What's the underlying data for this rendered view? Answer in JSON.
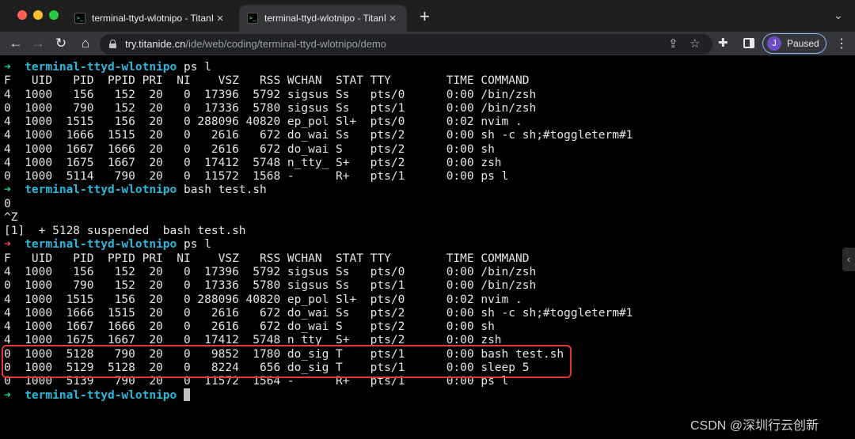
{
  "tabs": [
    {
      "title": "terminal-ttyd-wlotnipo - TitanIDE",
      "icon": "terminal-favicon-icon",
      "active": false
    },
    {
      "title": "terminal-ttyd-wlotnipo - TitanIDE",
      "icon": "terminal-favicon-icon",
      "active": true
    }
  ],
  "toolbar": {
    "url_host": "try.titanide.cn",
    "url_path": "/ide/web/coding/terminal-ttyd-wlotnipo/demo",
    "profile_initial": "J",
    "profile_status": "Paused"
  },
  "terminal": {
    "prompt_symbol": "➜",
    "directory": "terminal-ttyd-wlotnipo",
    "lines": [
      {
        "type": "prompt",
        "status": "ok",
        "cmd": "ps l"
      },
      {
        "type": "out",
        "text": "F   UID   PID  PPID PRI  NI    VSZ   RSS WCHAN  STAT TTY        TIME COMMAND"
      },
      {
        "type": "out",
        "text": "4  1000   156   152  20   0  17396  5792 sigsus Ss   pts/0      0:00 /bin/zsh"
      },
      {
        "type": "out",
        "text": "0  1000   790   152  20   0  17336  5780 sigsus Ss   pts/1      0:00 /bin/zsh"
      },
      {
        "type": "out",
        "text": "4  1000  1515   156  20   0 288096 40820 ep_pol Sl+  pts/0      0:02 nvim ."
      },
      {
        "type": "out",
        "text": "4  1000  1666  1515  20   0   2616   672 do_wai Ss   pts/2      0:00 sh -c sh;#toggleterm#1"
      },
      {
        "type": "out",
        "text": "4  1000  1667  1666  20   0   2616   672 do_wai S    pts/2      0:00 sh"
      },
      {
        "type": "out",
        "text": "4  1000  1675  1667  20   0  17412  5748 n_tty_ S+   pts/2      0:00 zsh"
      },
      {
        "type": "out",
        "text": "0  1000  5114   790  20   0  11572  1568 -      R+   pts/1      0:00 ps l"
      },
      {
        "type": "prompt",
        "status": "ok",
        "cmd": "bash test.sh"
      },
      {
        "type": "out",
        "text": "0"
      },
      {
        "type": "out",
        "text": "^Z"
      },
      {
        "type": "out",
        "text": "[1]  + 5128 suspended  bash test.sh"
      },
      {
        "type": "prompt",
        "status": "err",
        "cmd": "ps l"
      },
      {
        "type": "out",
        "text": "F   UID   PID  PPID PRI  NI    VSZ   RSS WCHAN  STAT TTY        TIME COMMAND"
      },
      {
        "type": "out",
        "text": "4  1000   156   152  20   0  17396  5792 sigsus Ss   pts/0      0:00 /bin/zsh"
      },
      {
        "type": "out",
        "text": "0  1000   790   152  20   0  17336  5780 sigsus Ss   pts/1      0:00 /bin/zsh"
      },
      {
        "type": "out",
        "text": "4  1000  1515   156  20   0 288096 40820 ep_pol Sl+  pts/0      0:02 nvim ."
      },
      {
        "type": "out",
        "text": "4  1000  1666  1515  20   0   2616   672 do_wai Ss   pts/2      0:00 sh -c sh;#toggleterm#1"
      },
      {
        "type": "out",
        "text": "4  1000  1667  1666  20   0   2616   672 do_wai S    pts/2      0:00 sh"
      },
      {
        "type": "out",
        "text": "4  1000  1675  1667  20   0  17412  5748 n_tty_ S+   pts/2      0:00 zsh"
      },
      {
        "type": "out",
        "text": "0  1000  5128   790  20   0   9852  1780 do_sig T    pts/1      0:00 bash test.sh"
      },
      {
        "type": "out",
        "text": "0  1000  5129  5128  20   0   8224   656 do_sig T    pts/1      0:00 sleep 5"
      },
      {
        "type": "out",
        "text": "0  1000  5139   790  20   0  11572  1564 -      R+   pts/1      0:00 ps l"
      },
      {
        "type": "prompt",
        "status": "ok",
        "cmd": "",
        "cursor": true
      }
    ]
  },
  "watermark": "CSDN @深圳行云创新",
  "colors": {
    "prompt_ok": "#23d18b",
    "prompt_err": "#f14c4c",
    "directory": "#29b8db",
    "highlight_box": "#e03a2f"
  }
}
